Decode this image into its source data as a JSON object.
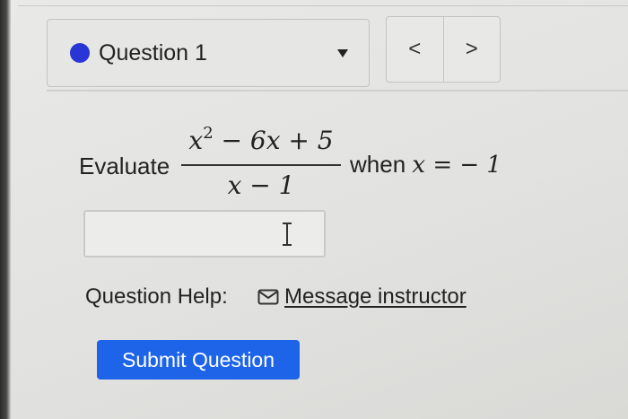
{
  "colors": {
    "status_dot": "#2a35d6",
    "submit_bg": "#1e64e8"
  },
  "question_selector": {
    "label": "Question 1",
    "status_icon": "filled-circle-icon",
    "dropdown_icon": "caret-down-icon"
  },
  "nav": {
    "prev_glyph": "<",
    "next_glyph": ">"
  },
  "problem": {
    "prompt": "Evaluate",
    "numerator_base": "x",
    "numerator_exp": "2",
    "numerator_rest": " − 6x + 5",
    "denominator": "x − 1",
    "when_label": "when ",
    "condition": "x = − 1"
  },
  "answer": {
    "value": "",
    "placeholder": ""
  },
  "help": {
    "label": "Question Help:",
    "link_text": "Message instructor",
    "link_icon": "envelope-icon"
  },
  "actions": {
    "submit_label": "Submit Question"
  }
}
